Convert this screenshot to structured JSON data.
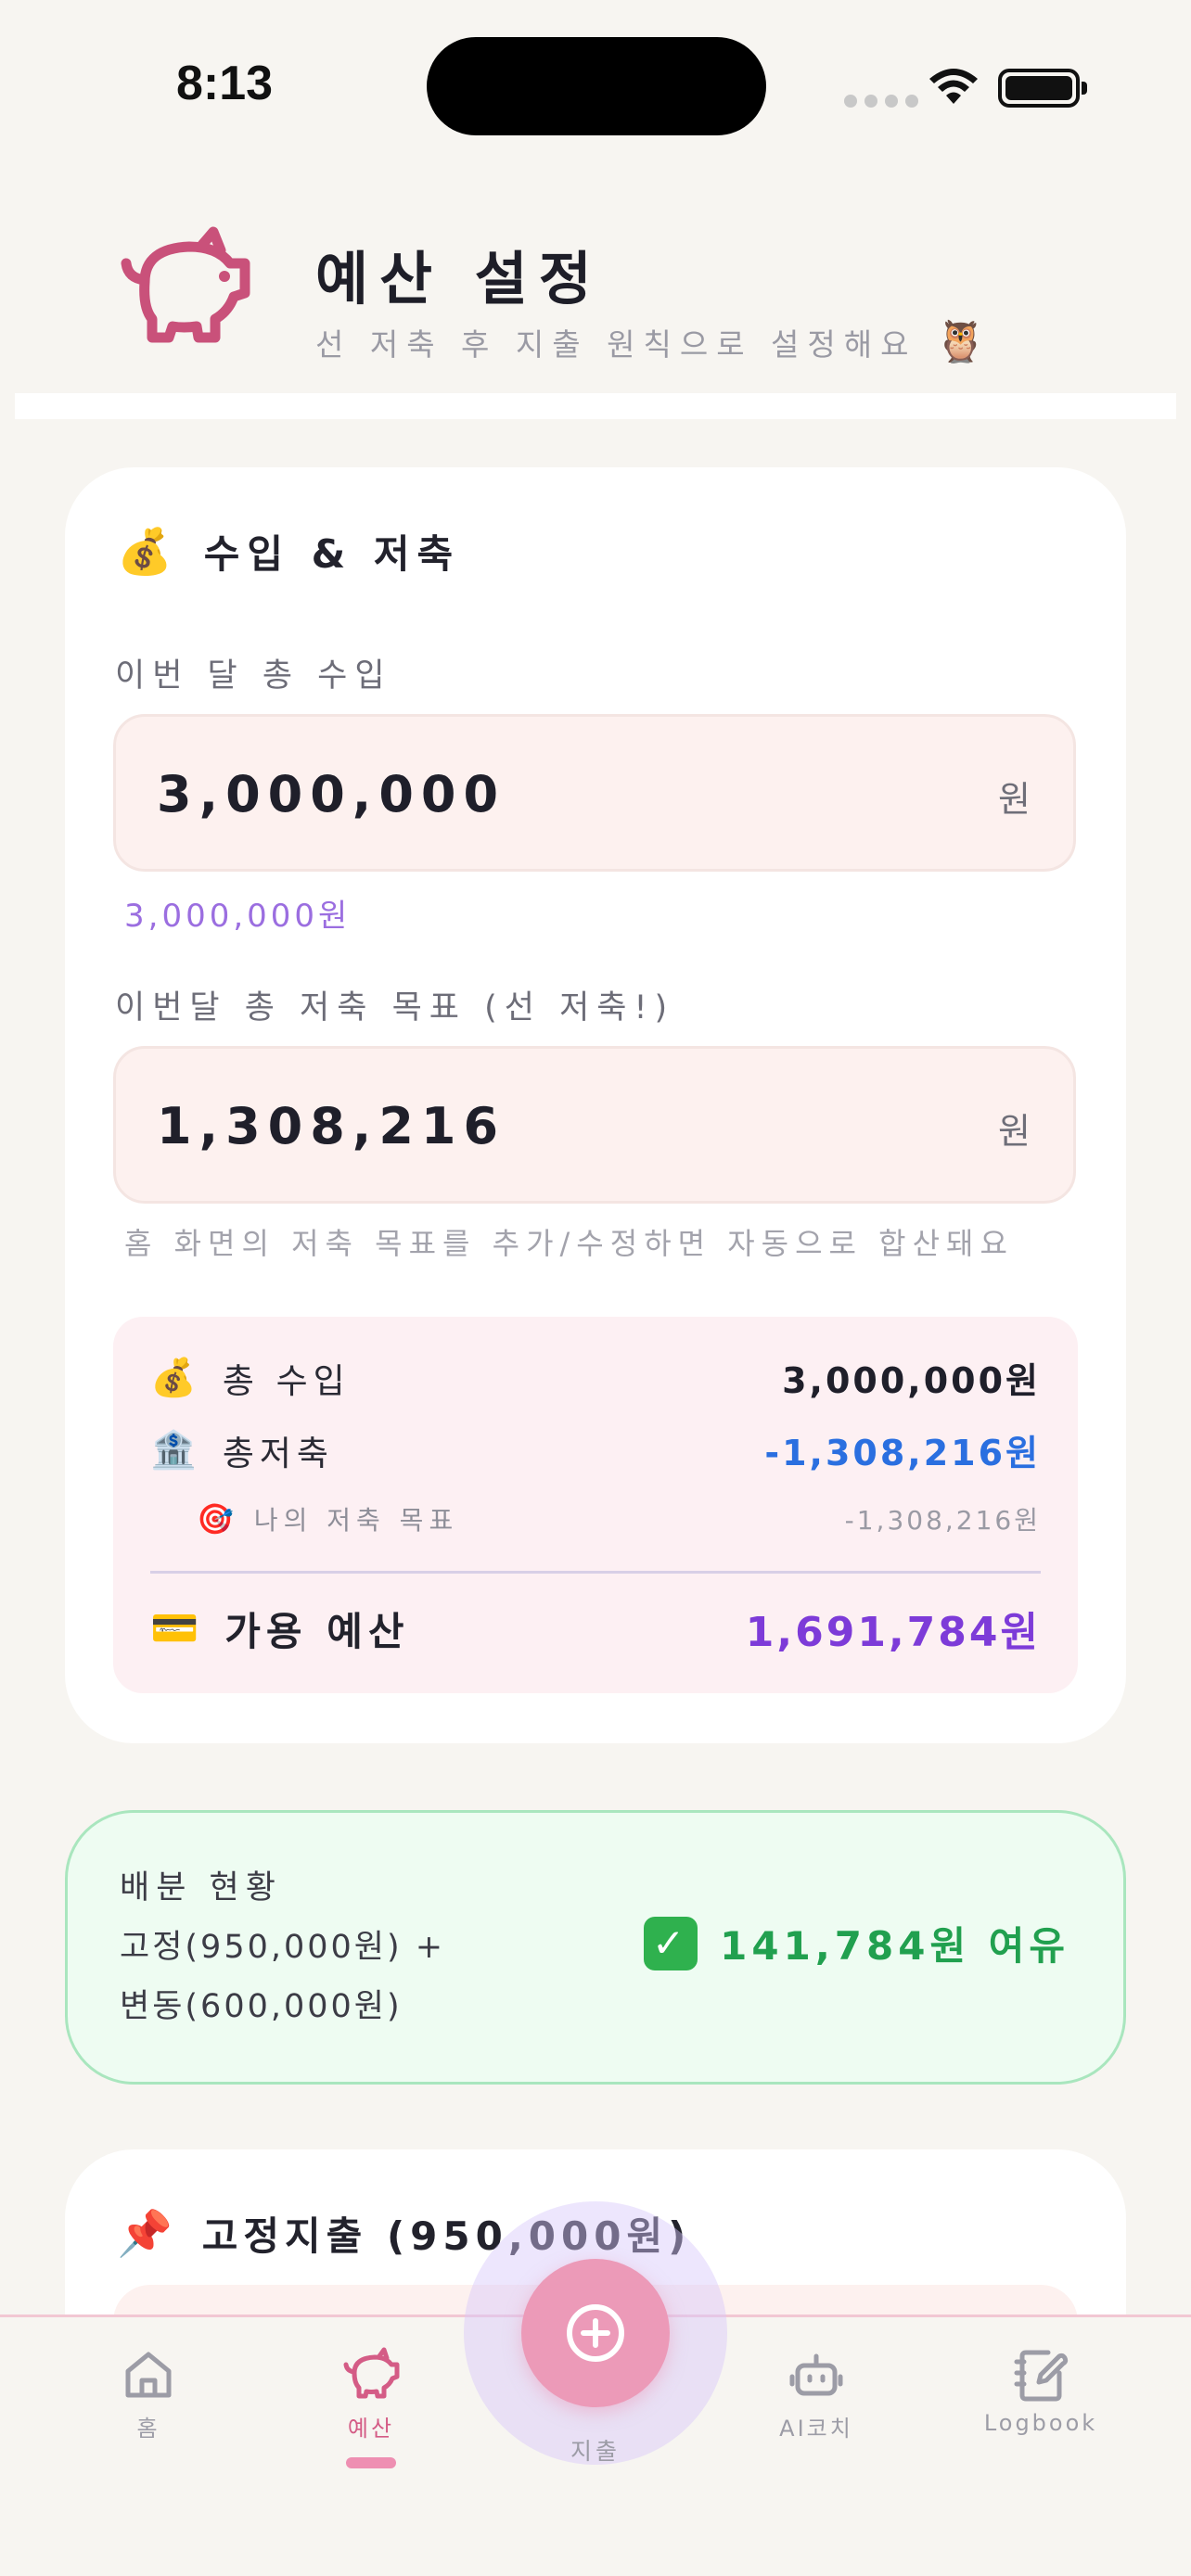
{
  "status_bar": {
    "time": "8:13"
  },
  "header": {
    "title": "예산 설정",
    "subtitle": "선 저축 후 지출 원칙으로 설정해요",
    "subtitle_emoji": "🦉"
  },
  "income_card": {
    "emoji": "💰",
    "title": "수입 & 저축",
    "income": {
      "label": "이번 달 총 수입",
      "value": "3,000,000",
      "unit": "원",
      "hint": "3,000,000원"
    },
    "savings": {
      "label": "이번달 총 저축 목표 (선 저축!)",
      "value": "1,308,216",
      "unit": "원",
      "hint": "홈 화면의 저축 목표를 추가/수정하면 자동으로 합산돼요"
    },
    "summary": {
      "income_emoji": "💰",
      "income_label": "총 수입",
      "income_value": "3,000,000원",
      "savings_emoji": "🏦",
      "savings_label": "총저축",
      "savings_value": "-1,308,216원",
      "goal_emoji": "🎯",
      "goal_label": "나의 저축 목표",
      "goal_value": "-1,308,216원",
      "available_emoji": "💳",
      "available_label": "가용 예산",
      "available_value": "1,691,784원"
    }
  },
  "allocation": {
    "title": "배분 현황",
    "line1": "고정(950,000원) +",
    "line2": "변동(600,000원)",
    "status_icon": "✓",
    "status_text": "141,784원 여유"
  },
  "fixed_card": {
    "emoji": "📌",
    "title": "고정지출 (950,000원)"
  },
  "tabbar": {
    "tabs": [
      {
        "label": "홈",
        "icon": "home-icon"
      },
      {
        "label": "예산",
        "icon": "piggy-bank-icon"
      },
      {
        "label": "지출",
        "icon": "plus-circle-icon"
      },
      {
        "label": "AI코치",
        "icon": "robot-icon"
      },
      {
        "label": "Logbook",
        "icon": "notebook-pen-icon"
      }
    ]
  },
  "colors": {
    "accent_pink": "#d45c86",
    "fab_pink": "#ec9ab8",
    "savings_blue": "#2a6fe0",
    "budget_purple": "#7d3bd8",
    "ok_green": "#21a04f"
  }
}
